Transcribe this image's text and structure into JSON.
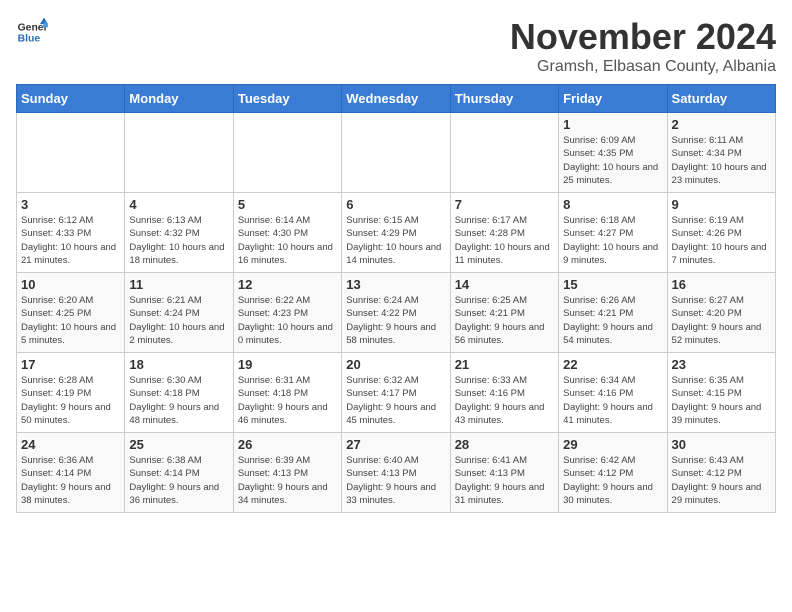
{
  "logo": {
    "line1": "General",
    "line2": "Blue"
  },
  "title": "November 2024",
  "location": "Gramsh, Elbasan County, Albania",
  "days_of_week": [
    "Sunday",
    "Monday",
    "Tuesday",
    "Wednesday",
    "Thursday",
    "Friday",
    "Saturday"
  ],
  "weeks": [
    [
      {
        "day": "",
        "info": ""
      },
      {
        "day": "",
        "info": ""
      },
      {
        "day": "",
        "info": ""
      },
      {
        "day": "",
        "info": ""
      },
      {
        "day": "",
        "info": ""
      },
      {
        "day": "1",
        "info": "Sunrise: 6:09 AM\nSunset: 4:35 PM\nDaylight: 10 hours and 25 minutes."
      },
      {
        "day": "2",
        "info": "Sunrise: 6:11 AM\nSunset: 4:34 PM\nDaylight: 10 hours and 23 minutes."
      }
    ],
    [
      {
        "day": "3",
        "info": "Sunrise: 6:12 AM\nSunset: 4:33 PM\nDaylight: 10 hours and 21 minutes."
      },
      {
        "day": "4",
        "info": "Sunrise: 6:13 AM\nSunset: 4:32 PM\nDaylight: 10 hours and 18 minutes."
      },
      {
        "day": "5",
        "info": "Sunrise: 6:14 AM\nSunset: 4:30 PM\nDaylight: 10 hours and 16 minutes."
      },
      {
        "day": "6",
        "info": "Sunrise: 6:15 AM\nSunset: 4:29 PM\nDaylight: 10 hours and 14 minutes."
      },
      {
        "day": "7",
        "info": "Sunrise: 6:17 AM\nSunset: 4:28 PM\nDaylight: 10 hours and 11 minutes."
      },
      {
        "day": "8",
        "info": "Sunrise: 6:18 AM\nSunset: 4:27 PM\nDaylight: 10 hours and 9 minutes."
      },
      {
        "day": "9",
        "info": "Sunrise: 6:19 AM\nSunset: 4:26 PM\nDaylight: 10 hours and 7 minutes."
      }
    ],
    [
      {
        "day": "10",
        "info": "Sunrise: 6:20 AM\nSunset: 4:25 PM\nDaylight: 10 hours and 5 minutes."
      },
      {
        "day": "11",
        "info": "Sunrise: 6:21 AM\nSunset: 4:24 PM\nDaylight: 10 hours and 2 minutes."
      },
      {
        "day": "12",
        "info": "Sunrise: 6:22 AM\nSunset: 4:23 PM\nDaylight: 10 hours and 0 minutes."
      },
      {
        "day": "13",
        "info": "Sunrise: 6:24 AM\nSunset: 4:22 PM\nDaylight: 9 hours and 58 minutes."
      },
      {
        "day": "14",
        "info": "Sunrise: 6:25 AM\nSunset: 4:21 PM\nDaylight: 9 hours and 56 minutes."
      },
      {
        "day": "15",
        "info": "Sunrise: 6:26 AM\nSunset: 4:21 PM\nDaylight: 9 hours and 54 minutes."
      },
      {
        "day": "16",
        "info": "Sunrise: 6:27 AM\nSunset: 4:20 PM\nDaylight: 9 hours and 52 minutes."
      }
    ],
    [
      {
        "day": "17",
        "info": "Sunrise: 6:28 AM\nSunset: 4:19 PM\nDaylight: 9 hours and 50 minutes."
      },
      {
        "day": "18",
        "info": "Sunrise: 6:30 AM\nSunset: 4:18 PM\nDaylight: 9 hours and 48 minutes."
      },
      {
        "day": "19",
        "info": "Sunrise: 6:31 AM\nSunset: 4:18 PM\nDaylight: 9 hours and 46 minutes."
      },
      {
        "day": "20",
        "info": "Sunrise: 6:32 AM\nSunset: 4:17 PM\nDaylight: 9 hours and 45 minutes."
      },
      {
        "day": "21",
        "info": "Sunrise: 6:33 AM\nSunset: 4:16 PM\nDaylight: 9 hours and 43 minutes."
      },
      {
        "day": "22",
        "info": "Sunrise: 6:34 AM\nSunset: 4:16 PM\nDaylight: 9 hours and 41 minutes."
      },
      {
        "day": "23",
        "info": "Sunrise: 6:35 AM\nSunset: 4:15 PM\nDaylight: 9 hours and 39 minutes."
      }
    ],
    [
      {
        "day": "24",
        "info": "Sunrise: 6:36 AM\nSunset: 4:14 PM\nDaylight: 9 hours and 38 minutes."
      },
      {
        "day": "25",
        "info": "Sunrise: 6:38 AM\nSunset: 4:14 PM\nDaylight: 9 hours and 36 minutes."
      },
      {
        "day": "26",
        "info": "Sunrise: 6:39 AM\nSunset: 4:13 PM\nDaylight: 9 hours and 34 minutes."
      },
      {
        "day": "27",
        "info": "Sunrise: 6:40 AM\nSunset: 4:13 PM\nDaylight: 9 hours and 33 minutes."
      },
      {
        "day": "28",
        "info": "Sunrise: 6:41 AM\nSunset: 4:13 PM\nDaylight: 9 hours and 31 minutes."
      },
      {
        "day": "29",
        "info": "Sunrise: 6:42 AM\nSunset: 4:12 PM\nDaylight: 9 hours and 30 minutes."
      },
      {
        "day": "30",
        "info": "Sunrise: 6:43 AM\nSunset: 4:12 PM\nDaylight: 9 hours and 29 minutes."
      }
    ]
  ]
}
